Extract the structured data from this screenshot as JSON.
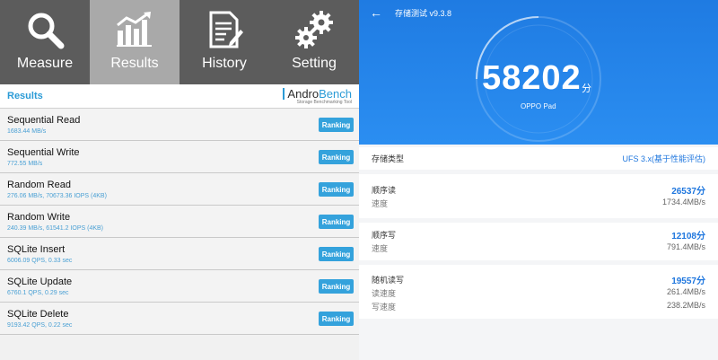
{
  "left": {
    "tabs": [
      {
        "label": "Measure",
        "icon": "search-icon"
      },
      {
        "label": "Results",
        "icon": "bar-chart-icon"
      },
      {
        "label": "History",
        "icon": "document-icon"
      },
      {
        "label": "Setting",
        "icon": "gears-icon"
      }
    ],
    "active_tab": "Results",
    "results_title": "Results",
    "logo": {
      "text_a": "Andro",
      "text_b": "Bench",
      "sub": "Storage Benchmarking Tool"
    },
    "rows": [
      {
        "name": "Sequential Read",
        "value": "1683.44 MB/s",
        "button": "Ranking"
      },
      {
        "name": "Sequential Write",
        "value": "772.55 MB/s",
        "button": "Ranking"
      },
      {
        "name": "Random Read",
        "value": "276.06 MB/s, 70673.36 IOPS (4KB)",
        "button": "Ranking"
      },
      {
        "name": "Random Write",
        "value": "240.39 MB/s, 61541.2 IOPS (4KB)",
        "button": "Ranking"
      },
      {
        "name": "SQLite Insert",
        "value": "6006.09 QPS, 0.33 sec",
        "button": "Ranking"
      },
      {
        "name": "SQLite Update",
        "value": "6760.1 QPS, 0.29 sec",
        "button": "Ranking"
      },
      {
        "name": "SQLite Delete",
        "value": "9193.42 QPS, 0.22 sec",
        "button": "Ranking"
      }
    ],
    "colors": {
      "accent": "#34a2dc",
      "tab_bg": "#5e5e5e",
      "tab_active": "#a9a9a9"
    }
  },
  "right": {
    "back": "←",
    "title": "存储测试 v9.3.8",
    "score": "58202",
    "score_unit": "分",
    "device": "OPPO Pad",
    "storage_type_label": "存储类型",
    "storage_type_value": "UFS 3.x(基于性能评估)",
    "sections": [
      {
        "title": "顺序读",
        "score": "26537分",
        "sub_label": "速度",
        "sub_value": "1734.4MB/s"
      },
      {
        "title": "顺序写",
        "score": "12108分",
        "sub_label": "速度",
        "sub_value": "791.4MB/s"
      },
      {
        "title": "随机读写",
        "score": "19557分",
        "read_label": "读速度",
        "read_value": "261.4MB/s",
        "write_label": "写速度",
        "write_value": "238.2MB/s"
      }
    ],
    "colors": {
      "hero": "#2b8ef1",
      "accent": "#1e76de"
    }
  }
}
